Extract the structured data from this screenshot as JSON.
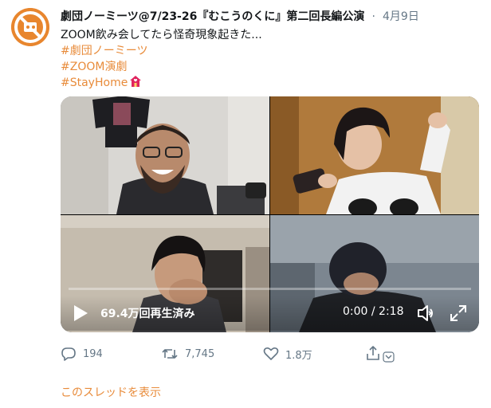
{
  "tweet": {
    "display_name": "劇団ノーミーツ@7/23-26『むこうのくに』第二回長編公演",
    "separator": "·",
    "date": "4月9日",
    "text_line": "ZOOM飲み会してたら怪奇現象起きた...",
    "hashtags": [
      "#劇団ノーミーツ",
      "#ZOOM演劇",
      "#StayHome"
    ]
  },
  "video": {
    "views": "69.4万回再生済み",
    "time": "0:00 / 2:18",
    "progress": 0.0
  },
  "actions": {
    "reply_count": "194",
    "retweet_count": "7,745",
    "like_count": "1.8万"
  },
  "thread_link": "このスレッドを表示",
  "colors": {
    "accent": "#e88b3a",
    "muted": "#657786",
    "text": "#14171a"
  }
}
